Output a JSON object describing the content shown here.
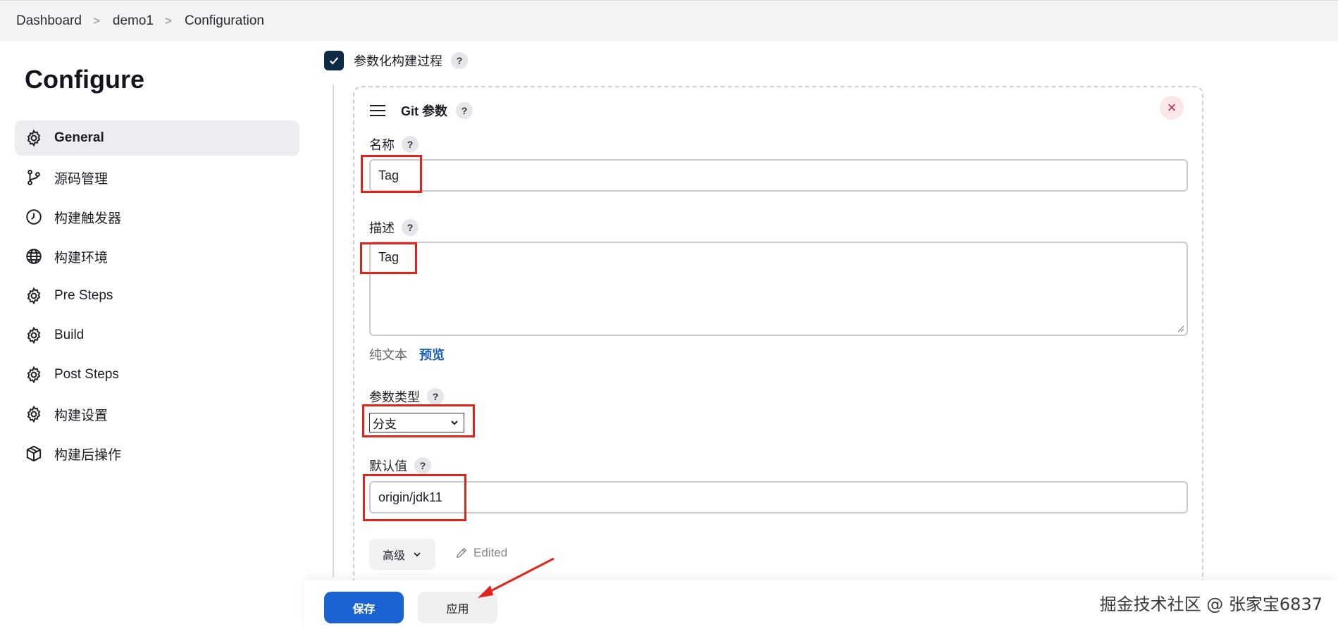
{
  "breadcrumb": {
    "items": [
      "Dashboard",
      "demo1",
      "Configuration"
    ]
  },
  "sidebar": {
    "title": "Configure",
    "items": [
      {
        "label": "General",
        "icon": "gear-icon"
      },
      {
        "label": "源码管理",
        "icon": "branch-icon"
      },
      {
        "label": "构建触发器",
        "icon": "clock-icon"
      },
      {
        "label": "构建环境",
        "icon": "globe-icon"
      },
      {
        "label": "Pre Steps",
        "icon": "gear-icon"
      },
      {
        "label": "Build",
        "icon": "gear-icon"
      },
      {
        "label": "Post Steps",
        "icon": "gear-icon"
      },
      {
        "label": "构建设置",
        "icon": "gear-icon"
      },
      {
        "label": "构建后操作",
        "icon": "cube-icon"
      }
    ]
  },
  "main": {
    "parameterized_label": "参数化构建过程",
    "help_glyph": "?",
    "card": {
      "title": "Git 参数",
      "close_glyph": "×",
      "name_label": "名称",
      "name_value": "Tag",
      "desc_label": "描述",
      "desc_value": "Tag",
      "format_plain": "纯文本",
      "format_preview": "预览",
      "type_label": "参数类型",
      "type_value": "分支",
      "default_label": "默认值",
      "default_value": "origin/jdk11",
      "advanced_label": "高级",
      "edited_label": "Edited"
    }
  },
  "footer": {
    "save_label": "保存",
    "apply_label": "应用"
  },
  "watermark": "掘金技术社区 @ 张家宝6837",
  "colors": {
    "primary": "#1b62d3",
    "checkbox": "#0e2a47",
    "annotation": "#e2231a",
    "close": "#d21c3a"
  }
}
